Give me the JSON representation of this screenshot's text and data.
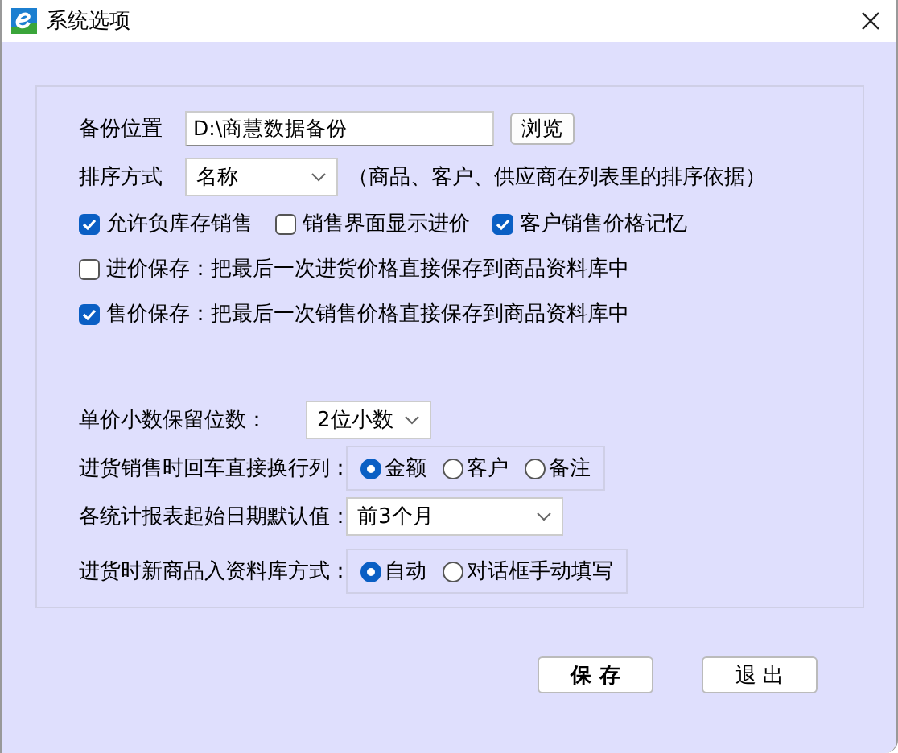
{
  "window": {
    "title": "系统选项"
  },
  "backup": {
    "label": "备份位置",
    "value": "D:\\商慧数据备份",
    "browse": "浏览"
  },
  "sort": {
    "label": "排序方式",
    "value": "名称",
    "note": "（商品、客户、供应商在列表里的排序依据）"
  },
  "check_rows": [
    [
      {
        "label": "允许负库存销售",
        "checked": true
      },
      {
        "label": "销售界面显示进价",
        "checked": false
      },
      {
        "label": "客户销售价格记忆",
        "checked": true
      }
    ],
    [
      {
        "label": "进价保存：把最后一次进货价格直接保存到商品资料库中",
        "checked": false
      }
    ],
    [
      {
        "label": "售价保存：把最后一次销售价格直接保存到商品资料库中",
        "checked": true
      }
    ]
  ],
  "settings": [
    {
      "kind": "select",
      "label": "单价小数保留位数：",
      "value": "2位小数"
    },
    {
      "kind": "radio",
      "label": "进货销售时回车直接换行列：",
      "options": [
        {
          "label": "金额",
          "selected": true
        },
        {
          "label": "客户",
          "selected": false
        },
        {
          "label": "备注",
          "selected": false
        }
      ]
    },
    {
      "kind": "select",
      "label": "各统计报表起始日期默认值：",
      "value": "前3个月"
    },
    {
      "kind": "radio",
      "label": "进货时新商品入资料库方式：",
      "options": [
        {
          "label": "自动",
          "selected": true
        },
        {
          "label": "对话框手动填写",
          "selected": false
        }
      ]
    }
  ],
  "buttons": [
    {
      "label": "保 存",
      "kind": "primary"
    },
    {
      "label": "退 出",
      "kind": "normal"
    }
  ]
}
